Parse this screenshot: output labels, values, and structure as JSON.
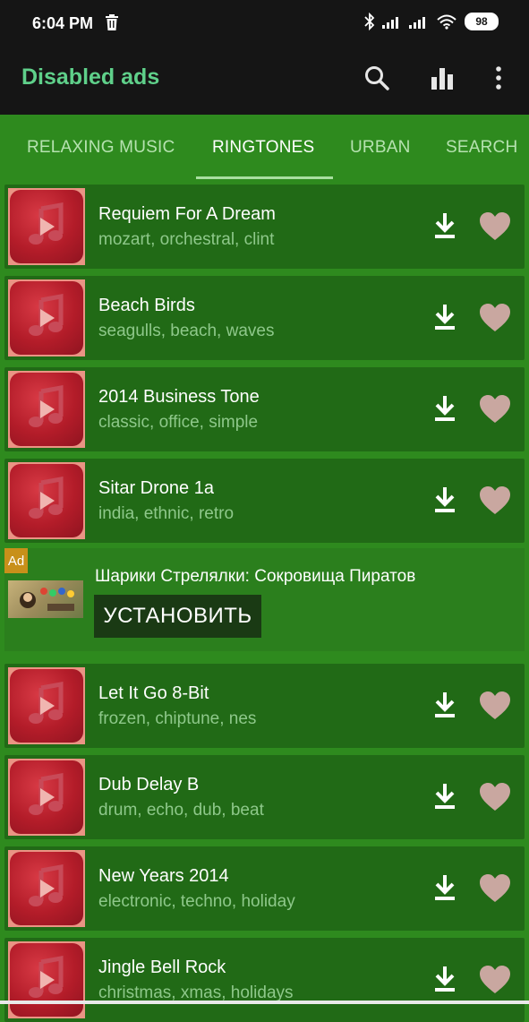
{
  "status_bar": {
    "time": "6:04 PM",
    "battery": "98"
  },
  "app_bar": {
    "title": "Disabled ads",
    "icons": [
      "search-icon",
      "bar-chart-icon",
      "more-vert-icon"
    ]
  },
  "tabs": [
    {
      "label": "RELAXING MUSIC",
      "active": false
    },
    {
      "label": "RINGTONES",
      "active": true
    },
    {
      "label": "URBAN",
      "active": false
    },
    {
      "label": "SEARCH",
      "active": false
    }
  ],
  "ringtones": [
    {
      "title": "Requiem For A Dream",
      "tags": "mozart, orchestral, clint"
    },
    {
      "title": "Beach Birds",
      "tags": "seagulls, beach, waves"
    },
    {
      "title": "2014 Business Tone",
      "tags": "classic, office, simple"
    },
    {
      "title": "Sitar Drone 1a",
      "tags": "india, ethnic, retro"
    },
    {
      "title": "Let It Go 8-Bit",
      "tags": "frozen, chiptune, nes"
    },
    {
      "title": "Dub Delay B",
      "tags": "drum, echo, dub, beat"
    },
    {
      "title": "New Years 2014",
      "tags": "electronic, techno, holiday"
    },
    {
      "title": "Jingle Bell Rock",
      "tags": "christmas, xmas, holidays"
    }
  ],
  "ad": {
    "badge": "Ad",
    "title": "Шарики Стрелялки: Сокровища Пиратов",
    "cta": "УСТАНОВИТЬ"
  },
  "colors": {
    "accent_title": "#5fd08a",
    "background": "#2e8a1e",
    "row_background": "#216a16",
    "heart": "#c9a7a0"
  }
}
